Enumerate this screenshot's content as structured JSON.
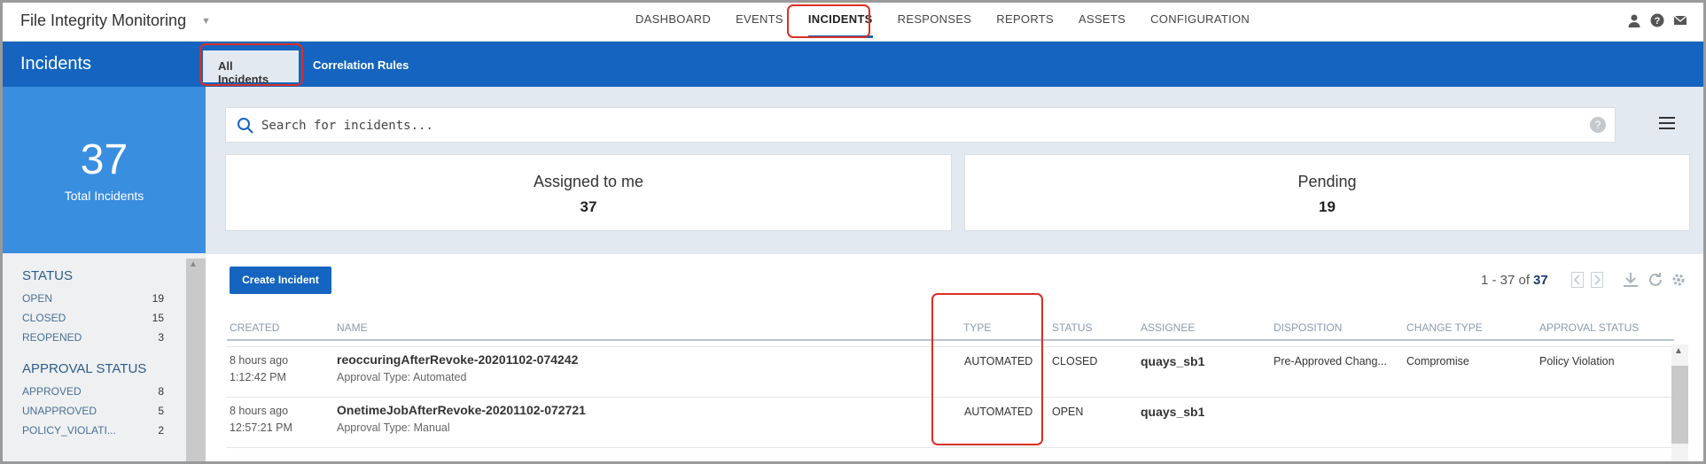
{
  "app": {
    "title": "File Integrity Monitoring"
  },
  "nav": {
    "items": [
      {
        "label": "DASHBOARD"
      },
      {
        "label": "EVENTS"
      },
      {
        "label": "INCIDENTS"
      },
      {
        "label": "RESPONSES"
      },
      {
        "label": "REPORTS"
      },
      {
        "label": "ASSETS"
      },
      {
        "label": "CONFIGURATION"
      }
    ],
    "active": "INCIDENTS"
  },
  "top_icons": [
    "user-icon",
    "help-icon",
    "mail-icon"
  ],
  "section": {
    "title": "Incidents"
  },
  "subtabs": [
    {
      "label": "All Incidents",
      "active": true
    },
    {
      "label": "Correlation Rules",
      "active": false
    }
  ],
  "summary": {
    "total": "37",
    "total_label": "Total Incidents"
  },
  "filters": {
    "status": {
      "title": "STATUS",
      "items": [
        {
          "label": "OPEN",
          "count": "19"
        },
        {
          "label": "CLOSED",
          "count": "15"
        },
        {
          "label": "REOPENED",
          "count": "3"
        }
      ]
    },
    "approval": {
      "title": "APPROVAL STATUS",
      "items": [
        {
          "label": "APPROVED",
          "count": "8"
        },
        {
          "label": "UNAPPROVED",
          "count": "5"
        },
        {
          "label": "POLICY_VIOLATI...",
          "count": "2"
        }
      ]
    }
  },
  "search": {
    "placeholder": "Search for incidents..."
  },
  "cards": [
    {
      "title": "Assigned to me",
      "value": "37"
    },
    {
      "title": "Pending",
      "value": "19"
    }
  ],
  "toolbar": {
    "create_label": "Create Incident"
  },
  "pager": {
    "range": "1 - 37 of",
    "total": "37"
  },
  "table": {
    "columns": [
      "CREATED",
      "NAME",
      "TYPE",
      "STATUS",
      "ASSIGNEE",
      "DISPOSITION",
      "CHANGE TYPE",
      "APPROVAL STATUS"
    ],
    "rows": [
      {
        "created_rel": "8 hours ago",
        "created_time": "1:12:42 PM",
        "name": "reoccuringAfterRevoke-20201102-074242",
        "approval_type": "Approval Type: Automated",
        "type": "AUTOMATED",
        "status": "CLOSED",
        "assignee": "quays_sb1",
        "disposition": "Pre-Approved Chang...",
        "change_type": "Compromise",
        "approval_status": "Policy Violation"
      },
      {
        "created_rel": "8 hours ago",
        "created_time": "12:57:21 PM",
        "name": "OnetimeJobAfterRevoke-20201102-072721",
        "approval_type": "Approval Type: Manual",
        "type": "AUTOMATED",
        "status": "OPEN",
        "assignee": "quays_sb1",
        "disposition": "",
        "change_type": "",
        "approval_status": ""
      }
    ]
  },
  "colors": {
    "brand_blue": "#1565c0",
    "highlight_red": "#d93025",
    "summary_blue": "#3a8ee0"
  }
}
